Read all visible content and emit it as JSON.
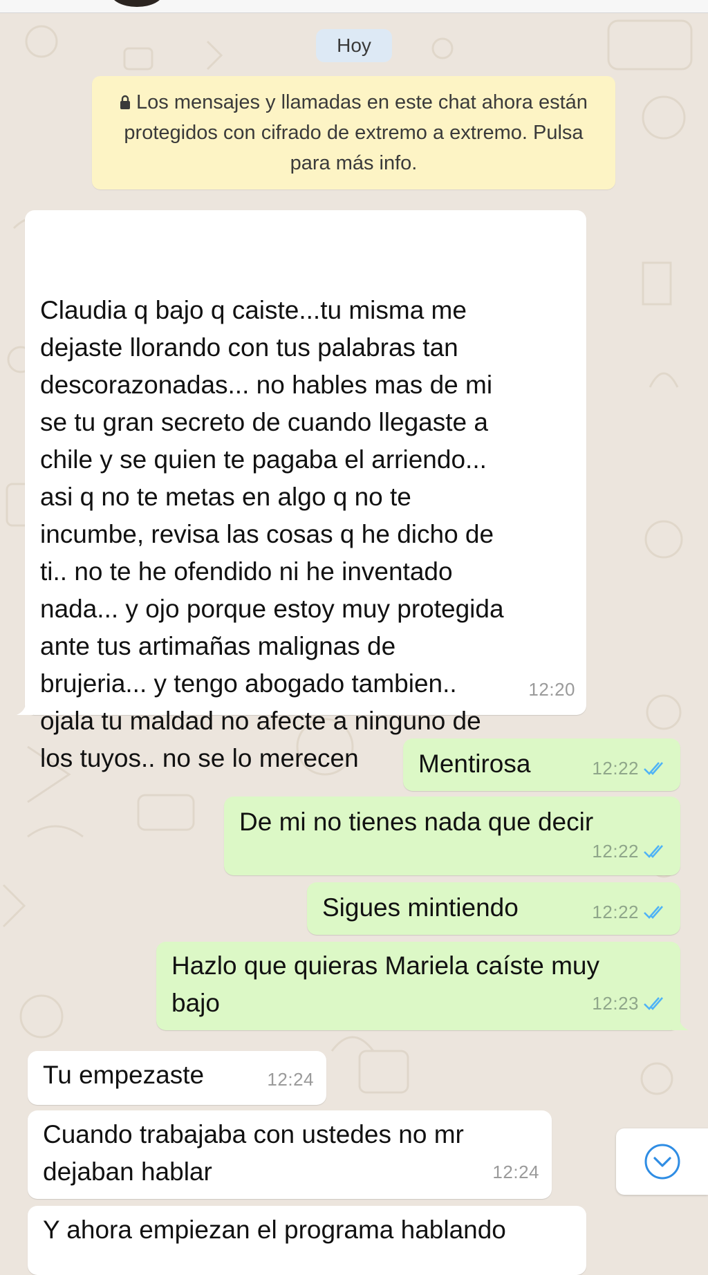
{
  "date_separator": "Hoy",
  "system_notice": "Los mensajes y llamadas en este chat ahora están protegidos con cifrado de extremo a extremo. Pulsa para más info.",
  "messages": [
    {
      "direction": "incoming",
      "lines": [
        "Claudia q bajo q caiste...tu misma me",
        "dejaste llorando con tus palabras tan",
        "descorazonadas... no hables mas de mi",
        "se tu gran secreto de cuando llegaste a",
        "chile y se quien te pagaba el arriendo...",
        "asi q no te metas en algo q no te",
        "incumbe, revisa las cosas q he dicho de",
        "ti.. no te he ofendido ni he inventado",
        "nada... y ojo porque estoy muy protegida",
        "ante tus artimañas malignas de",
        "brujeria... y tengo abogado tambien..",
        "ojala tu maldad no afecte a ninguno de",
        "los tuyos.. no se lo merecen"
      ],
      "time": "12:20"
    },
    {
      "direction": "outgoing",
      "lines": [
        "Mentirosa"
      ],
      "time": "12:22",
      "status": "read"
    },
    {
      "direction": "outgoing",
      "lines": [
        "De mi no tienes nada que decir"
      ],
      "time": "12:22",
      "status": "read"
    },
    {
      "direction": "outgoing",
      "lines": [
        "Sigues mintiendo"
      ],
      "time": "12:22",
      "status": "read"
    },
    {
      "direction": "outgoing",
      "lines": [
        "Hazlo que quieras Mariela caíste muy",
        "bajo"
      ],
      "time": "12:23",
      "status": "read"
    },
    {
      "direction": "incoming",
      "lines": [
        "Tu empezaste"
      ],
      "time": "12:24"
    },
    {
      "direction": "incoming",
      "lines": [
        "Cuando trabajaba con ustedes no mr",
        "dejaban hablar"
      ],
      "time": "12:24"
    },
    {
      "direction": "incoming",
      "lines": [
        "Y ahora empiezan el programa hablando"
      ],
      "time": ""
    }
  ],
  "icons": {
    "lock": "lock-icon",
    "read_receipt": "double-check-icon",
    "scroll_down": "chevron-down-circle-icon"
  },
  "colors": {
    "background": "#ece5dd",
    "incoming_bubble": "#ffffff",
    "outgoing_bubble": "#dcf8c6",
    "notice": "#fdf4c5",
    "date_pill": "#dde9f5",
    "read_ticks": "#4fb3f6",
    "scroll_accent": "#2f8de4"
  }
}
